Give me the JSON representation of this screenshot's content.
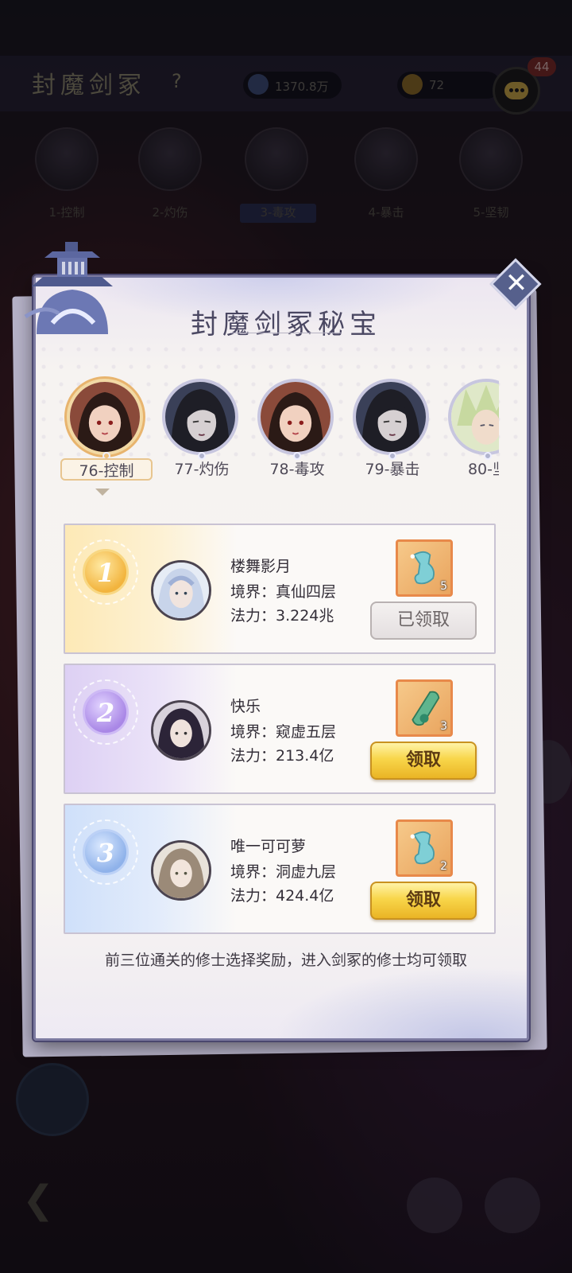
{
  "background": {
    "title": "封魔剑冢",
    "help": "?",
    "resource1": "1370.8万",
    "resource2": "72",
    "chat_badge": "44",
    "boss_labels": [
      "1-控制",
      "2-灼伤",
      "3-毒攻",
      "4-暴击",
      "5-坚韧"
    ]
  },
  "panel": {
    "title": "封魔剑冢秘宝",
    "close": "✕",
    "tabs": [
      {
        "label": "76-控制",
        "active": true
      },
      {
        "label": "77-灼伤",
        "active": false
      },
      {
        "label": "78-毒攻",
        "active": false
      },
      {
        "label": "79-暴击",
        "active": false
      },
      {
        "label": "80-坚",
        "active": false
      }
    ],
    "ranks": [
      {
        "rank": "1",
        "name": "楼舞影月",
        "realm": "境界：真仙四层",
        "power": "法力：3.224兆",
        "reward_count": "5",
        "button": "已领取",
        "claimed": true
      },
      {
        "rank": "2",
        "name": "快乐",
        "realm": "境界：窥虚五层",
        "power": "法力：213.4亿",
        "reward_count": "3",
        "button": "领取",
        "claimed": false
      },
      {
        "rank": "3",
        "name": "唯一可可萝",
        "realm": "境界：洞虚九层",
        "power": "法力：424.4亿",
        "reward_count": "2",
        "button": "领取",
        "claimed": false
      }
    ],
    "footer": "前三位通关的修士选择奖励，进入剑冢的修士均可领取"
  },
  "colors": {
    "gold": "#f2b43e",
    "purple": "#a987e6",
    "blue": "#8fb2ea",
    "claim_button": "#f8d64a"
  },
  "icons": [
    "chat-icon",
    "close-icon",
    "reward-item-icon",
    "back-arrow-icon"
  ]
}
